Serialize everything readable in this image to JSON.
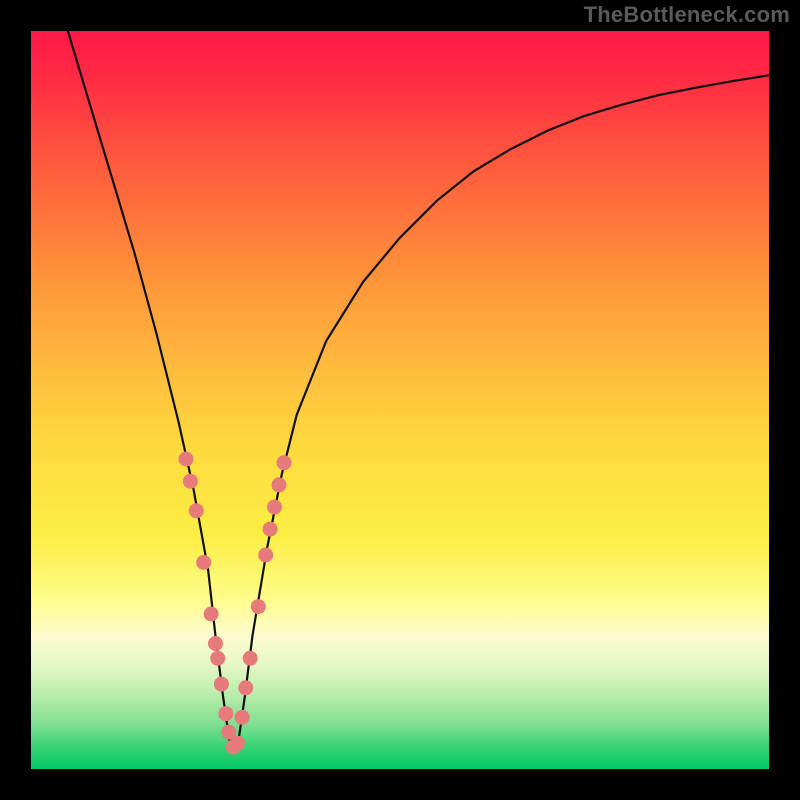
{
  "brand": {
    "label": "TheBottleneck.com"
  },
  "colors": {
    "background": "#000000",
    "curve_stroke": "#101010",
    "dot_fill": "#e77a7a",
    "gradient_top": "#ff1846",
    "gradient_bottom": "#00c864"
  },
  "chart_data": {
    "type": "line",
    "title": "",
    "xlabel": "",
    "ylabel": "",
    "x_range": [
      0,
      100
    ],
    "y_range": [
      0,
      100
    ],
    "note": "No axis tick labels are visible in the image; x and y are in percent of plot area. The curve depicts a V-shaped bottleneck profile (high at edges, minimum near x≈27, rising again toward the right).",
    "series": [
      {
        "name": "bottleneck-curve",
        "x": [
          5,
          8,
          11,
          14,
          17,
          20,
          22,
          24,
          25,
          26,
          27,
          28,
          29,
          30,
          32,
          34,
          36,
          40,
          45,
          50,
          55,
          60,
          65,
          70,
          75,
          80,
          85,
          90,
          95,
          100
        ],
        "y": [
          100,
          90,
          80,
          70,
          59,
          47,
          38,
          27,
          18,
          10,
          3,
          3,
          10,
          18,
          30,
          40,
          48,
          58,
          66,
          72,
          77,
          81,
          84,
          86.5,
          88.5,
          90,
          91.3,
          92.3,
          93.2,
          94
        ]
      }
    ],
    "highlight_points": {
      "name": "sample-dots",
      "note": "Pink/salmon dots clustered along the lower portion of the V; coordinates in percent of plot area.",
      "points": [
        {
          "x": 21.0,
          "y": 42.0
        },
        {
          "x": 21.6,
          "y": 39.0
        },
        {
          "x": 22.4,
          "y": 35.0
        },
        {
          "x": 23.4,
          "y": 28.0
        },
        {
          "x": 24.4,
          "y": 21.0
        },
        {
          "x": 25.0,
          "y": 17.0
        },
        {
          "x": 25.3,
          "y": 15.0
        },
        {
          "x": 25.8,
          "y": 11.5
        },
        {
          "x": 26.4,
          "y": 7.5
        },
        {
          "x": 26.8,
          "y": 5.0
        },
        {
          "x": 27.4,
          "y": 3.0
        },
        {
          "x": 28.0,
          "y": 3.5
        },
        {
          "x": 28.6,
          "y": 7.0
        },
        {
          "x": 29.1,
          "y": 11.0
        },
        {
          "x": 29.7,
          "y": 15.0
        },
        {
          "x": 30.8,
          "y": 22.0
        },
        {
          "x": 31.8,
          "y": 29.0
        },
        {
          "x": 32.4,
          "y": 32.5
        },
        {
          "x": 33.0,
          "y": 35.5
        },
        {
          "x": 33.6,
          "y": 38.5
        },
        {
          "x": 34.3,
          "y": 41.5
        }
      ]
    }
  }
}
